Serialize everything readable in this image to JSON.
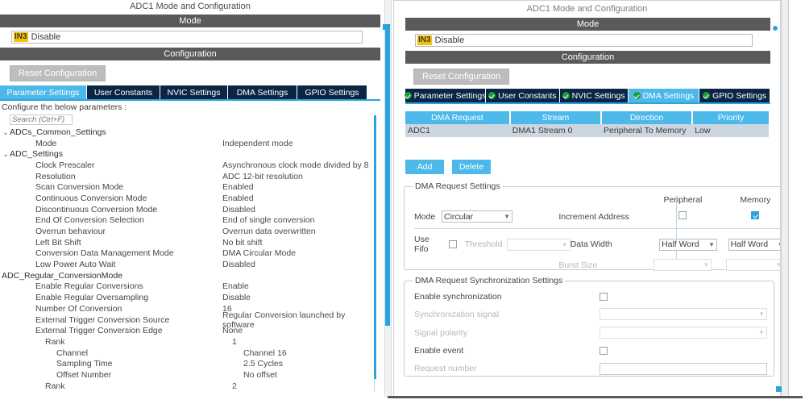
{
  "left": {
    "title": "ADC1 Mode and Configuration",
    "mode_bar": "Mode",
    "mode_badge": "IN3",
    "mode_value": "Disable",
    "configuration_bar": "Configuration",
    "reset_button": "Reset Configuration",
    "tabs": [
      {
        "label": "Parameter Settings",
        "active": true
      },
      {
        "label": "User Constants",
        "active": false
      },
      {
        "label": "NVIC Settings",
        "active": false
      },
      {
        "label": "DMA Settings",
        "active": false
      },
      {
        "label": "GPIO Settings",
        "active": false
      }
    ],
    "hint": "Configure the below parameters :",
    "search_placeholder": "Search (Ctrl+F)",
    "params": [
      {
        "kind": "group",
        "indent": 0,
        "caret": "⌄",
        "name": "ADCs_Common_Settings",
        "value": ""
      },
      {
        "kind": "param",
        "indent": 2,
        "caret": "",
        "name": "Mode",
        "value": "Independent mode"
      },
      {
        "kind": "group",
        "indent": 0,
        "caret": "⌄",
        "name": "ADC_Settings",
        "value": ""
      },
      {
        "kind": "param",
        "indent": 2,
        "caret": "",
        "name": "Clock Prescaler",
        "value": "Asynchronous clock mode divided by 8"
      },
      {
        "kind": "param",
        "indent": 2,
        "caret": "",
        "name": "Resolution",
        "value": "ADC 12-bit resolution"
      },
      {
        "kind": "param",
        "indent": 2,
        "caret": "",
        "name": "Scan Conversion Mode",
        "value": "Enabled"
      },
      {
        "kind": "param",
        "indent": 2,
        "caret": "",
        "name": "Continuous Conversion Mode",
        "value": "Enabled"
      },
      {
        "kind": "param",
        "indent": 2,
        "caret": "",
        "name": "Discontinuous Conversion Mode",
        "value": "Disabled"
      },
      {
        "kind": "param",
        "indent": 2,
        "caret": "",
        "name": "End Of Conversion Selection",
        "value": "End of single conversion"
      },
      {
        "kind": "param",
        "indent": 2,
        "caret": "",
        "name": "Overrun behaviour",
        "value": "Overrun data overwritten"
      },
      {
        "kind": "param",
        "indent": 2,
        "caret": "",
        "name": "Left Bit Shift",
        "value": "No bit shift"
      },
      {
        "kind": "param",
        "indent": 2,
        "caret": "",
        "name": "Conversion Data Management Mode",
        "value": "DMA Circular Mode"
      },
      {
        "kind": "param",
        "indent": 2,
        "caret": "",
        "name": "Low Power Auto Wait",
        "value": "Disabled"
      },
      {
        "kind": "group",
        "indent": 0,
        "caret": "",
        "name": "ADC_Regular_ConversionMode",
        "value": ""
      },
      {
        "kind": "param",
        "indent": 2,
        "caret": "",
        "name": "Enable Regular Conversions",
        "value": "Enable"
      },
      {
        "kind": "param",
        "indent": 2,
        "caret": "",
        "name": "Enable Regular Oversampling",
        "value": "Disable"
      },
      {
        "kind": "param",
        "indent": 2,
        "caret": "",
        "name": "Number Of Conversion",
        "value": "16"
      },
      {
        "kind": "param",
        "indent": 2,
        "caret": "",
        "name": "External Trigger Conversion Source",
        "value": "Regular Conversion launched by software"
      },
      {
        "kind": "param",
        "indent": 2,
        "caret": "",
        "name": "External Trigger Conversion Edge",
        "value": "None"
      },
      {
        "kind": "param",
        "indent": 3,
        "caret": "",
        "name": "Rank",
        "value": "1"
      },
      {
        "kind": "param",
        "indent": 4,
        "caret": "",
        "name": "Channel",
        "value": "Channel 16"
      },
      {
        "kind": "param",
        "indent": 4,
        "caret": "",
        "name": "Sampling Time",
        "value": "2.5 Cycles"
      },
      {
        "kind": "param",
        "indent": 4,
        "caret": "",
        "name": "Offset Number",
        "value": "No offset"
      },
      {
        "kind": "param",
        "indent": 3,
        "caret": "",
        "name": "Rank",
        "value": "2"
      }
    ]
  },
  "right": {
    "title": "ADC1 Mode and Configuration",
    "mode_bar": "Mode",
    "mode_badge": "IN3",
    "mode_value": "Disable",
    "configuration_bar": "Configuration",
    "reset_button": "Reset Configuration",
    "tabs": [
      {
        "label": "Parameter Settings",
        "active": false,
        "check": true
      },
      {
        "label": "User Constants",
        "active": false,
        "check": true
      },
      {
        "label": "NVIC Settings",
        "active": false,
        "check": true
      },
      {
        "label": "DMA Settings",
        "active": true,
        "check": true
      },
      {
        "label": "GPIO Settings",
        "active": false,
        "check": true
      }
    ],
    "dma_table": {
      "headers": [
        "DMA Request",
        "Stream",
        "Direction",
        "Priority"
      ],
      "rows": [
        [
          "ADC1",
          "DMA1 Stream 0",
          "Peripheral To Memory",
          "Low"
        ]
      ]
    },
    "add_button": "Add",
    "delete_button": "Delete",
    "request_settings": {
      "legend": "DMA Request Settings",
      "col_peripheral": "Peripheral",
      "col_memory": "Memory",
      "mode_label": "Mode",
      "mode_value": "Circular",
      "increment_address_label": "Increment Address",
      "increment_peripheral_checked": false,
      "increment_memory_checked": true,
      "use_fifo_label": "Use Fifo",
      "use_fifo_checked": false,
      "threshold_label": "Threshold",
      "threshold_value": "",
      "data_width_label": "Data Width",
      "data_width_peripheral": "Half Word",
      "data_width_memory": "Half Word",
      "burst_size_label": "Burst Size",
      "burst_size_peripheral": "",
      "burst_size_memory": ""
    },
    "sync_settings": {
      "legend": "DMA Request Synchronization Settings",
      "enable_sync_label": "Enable synchronization",
      "enable_sync_checked": false,
      "sync_signal_label": "Synchronization signal",
      "sync_signal_value": "",
      "signal_polarity_label": "Signal polarity",
      "signal_polarity_value": "",
      "enable_event_label": "Enable event",
      "enable_event_checked": false,
      "request_number_label": "Request number",
      "request_number_value": ""
    }
  },
  "colors": {
    "accent_blue": "#2aa3e0",
    "tab_active": "#4db8ea",
    "tab_inactive": "#0b2545",
    "section_bar": "#5a5a5c",
    "badge_yellow": "#f5c400",
    "check_green": "#1f9d3a",
    "table_row": "#ccd6e0"
  }
}
